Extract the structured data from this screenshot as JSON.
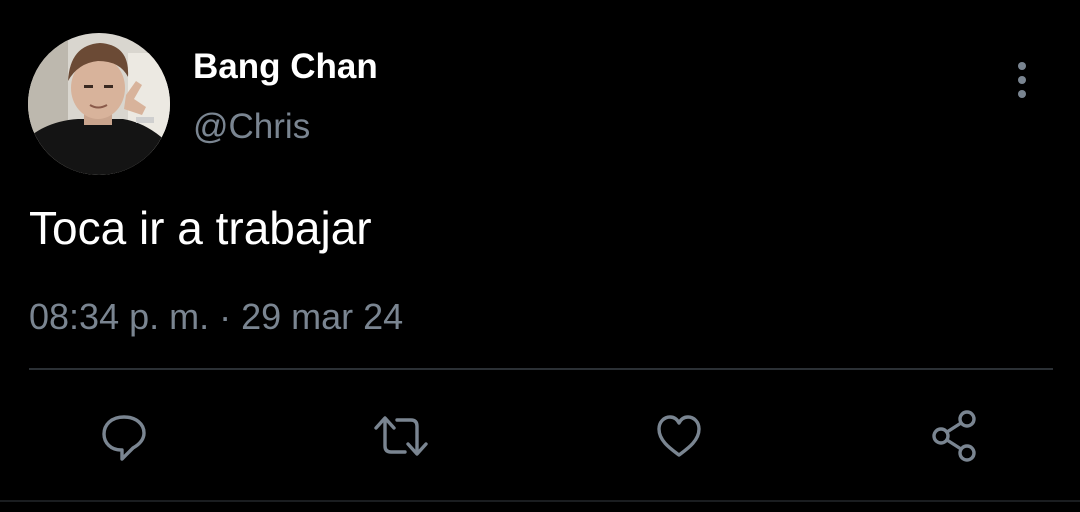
{
  "tweet": {
    "author": {
      "display_name": "Bang Chan",
      "handle": "@Chris",
      "avatar_icon": "profile-photo"
    },
    "text": "Toca ir a trabajar",
    "time": "08:34 p. m.",
    "separator": "·",
    "date": "29 mar 24"
  },
  "actions": [
    {
      "name": "reply",
      "icon": "speech-bubble-icon"
    },
    {
      "name": "retweet",
      "icon": "retweet-arrows-icon"
    },
    {
      "name": "like",
      "icon": "heart-icon"
    },
    {
      "name": "share",
      "icon": "share-icon"
    }
  ],
  "colors": {
    "background": "#000000",
    "text_primary": "#ffffff",
    "text_secondary": "#7a8591",
    "divider": "#2b3035"
  }
}
